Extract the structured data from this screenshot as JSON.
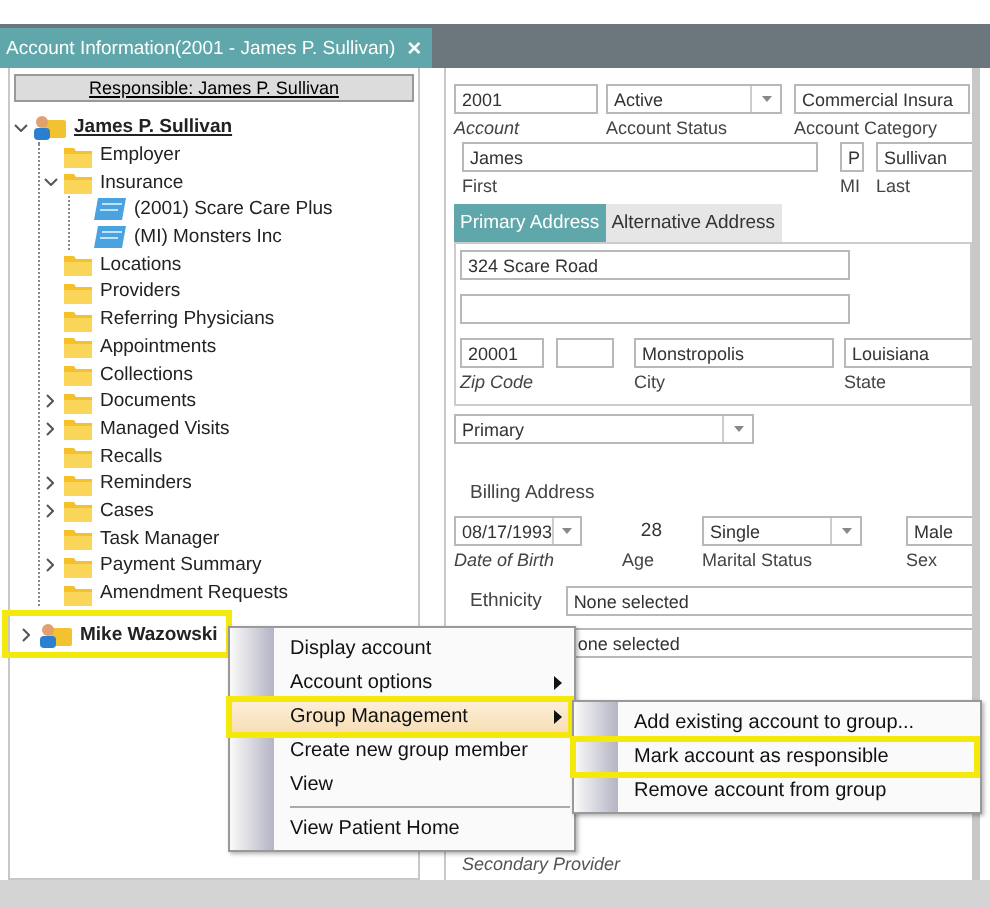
{
  "window": {
    "tab_title": "Account Information(2001 - James P. Sullivan)",
    "close_glyph": "×"
  },
  "responsible_header": "Responsible: James P. Sullivan",
  "tree": [
    {
      "label": "James P. Sullivan",
      "kind": "person",
      "expanded": true,
      "highlighted": false,
      "children": [
        {
          "label": "Employer",
          "kind": "folder"
        },
        {
          "label": "Insurance",
          "kind": "folder",
          "expanded": true,
          "children": [
            {
              "label": "(2001) Scare Care Plus",
              "kind": "card"
            },
            {
              "label": "(MI) Monsters Inc",
              "kind": "card"
            }
          ]
        },
        {
          "label": "Locations",
          "kind": "folder"
        },
        {
          "label": "Providers",
          "kind": "folder"
        },
        {
          "label": "Referring Physicians",
          "kind": "folder"
        },
        {
          "label": "Appointments",
          "kind": "folder"
        },
        {
          "label": "Collections",
          "kind": "folder"
        },
        {
          "label": "Documents",
          "kind": "folder",
          "expanded": false
        },
        {
          "label": "Managed Visits",
          "kind": "folder",
          "expanded": false
        },
        {
          "label": "Recalls",
          "kind": "folder"
        },
        {
          "label": "Reminders",
          "kind": "folder",
          "expanded": false
        },
        {
          "label": "Cases",
          "kind": "folder",
          "expanded": false
        },
        {
          "label": "Task Manager",
          "kind": "folder"
        },
        {
          "label": "Payment Summary",
          "kind": "folder",
          "expanded": false
        },
        {
          "label": "Amendment Requests",
          "kind": "folder"
        }
      ]
    },
    {
      "label": "Mike Wazowski",
      "kind": "person",
      "expanded": false,
      "highlighted": true
    }
  ],
  "account_fields": [
    {
      "kind": "text",
      "value": "2001",
      "label": "Account",
      "required": true
    },
    {
      "kind": "dropdown",
      "value": "Active",
      "label": "Account Status",
      "required": false
    },
    {
      "kind": "text",
      "value": "Commercial Insura",
      "label": "Account Category",
      "required": false
    }
  ],
  "name_fields": [
    {
      "kind": "text",
      "value": "James",
      "label": "First",
      "required": false
    },
    {
      "kind": "text",
      "value": "P",
      "label": "MI",
      "required": false
    },
    {
      "kind": "text",
      "value": "Sullivan",
      "label": "Last",
      "required": false
    }
  ],
  "address_tabs": [
    {
      "label": "Primary Address",
      "selected": true
    },
    {
      "label": "Alternative Address",
      "selected": false
    }
  ],
  "address_line": "324 Scare Road",
  "locality_fields": [
    {
      "kind": "text",
      "value": "20001",
      "label": "Zip Code",
      "required": true
    },
    {
      "kind": "blank"
    },
    {
      "kind": "text",
      "value": "Monstropolis",
      "label": "City",
      "required": false
    },
    {
      "kind": "text",
      "value": "Louisiana",
      "label": "State",
      "required": false
    }
  ],
  "billing": {
    "value": "Primary",
    "label": "Billing Address"
  },
  "personal_fields": [
    {
      "kind": "dropdown",
      "value": "08/17/1993",
      "label": "Date of Birth",
      "required": true
    },
    {
      "kind": "readout",
      "value": "28",
      "label": "Age",
      "required": false
    },
    {
      "kind": "dropdown",
      "value": "Single",
      "label": "Marital Status",
      "required": false
    },
    {
      "kind": "text",
      "value": "Male",
      "label": "Sex",
      "required": false
    }
  ],
  "ethnicity": {
    "label": "Ethnicity",
    "value": "None selected"
  },
  "second_selection": {
    "value": "one selected"
  },
  "secondary_provider_label": "Secondary Provider",
  "context_menu": [
    {
      "kind": "item",
      "label": "Display account",
      "has_submenu": false,
      "selected": false,
      "highlighted": false
    },
    {
      "kind": "item",
      "label": "Account options",
      "has_submenu": true,
      "selected": false,
      "highlighted": false
    },
    {
      "kind": "item",
      "label": "Group Management",
      "has_submenu": true,
      "selected": true,
      "highlighted": true
    },
    {
      "kind": "item",
      "label": "Create new group member",
      "has_submenu": false,
      "selected": false,
      "highlighted": false
    },
    {
      "kind": "item",
      "label": "View",
      "has_submenu": false,
      "selected": false,
      "highlighted": false
    },
    {
      "kind": "separator"
    },
    {
      "kind": "item",
      "label": "View Patient Home",
      "has_submenu": false,
      "selected": false,
      "highlighted": false
    }
  ],
  "submenu": [
    {
      "label": "Add existing account to group...",
      "highlighted": false
    },
    {
      "label": "Mark account as responsible",
      "highlighted": true
    },
    {
      "label": "Remove account from group",
      "highlighted": false
    }
  ]
}
